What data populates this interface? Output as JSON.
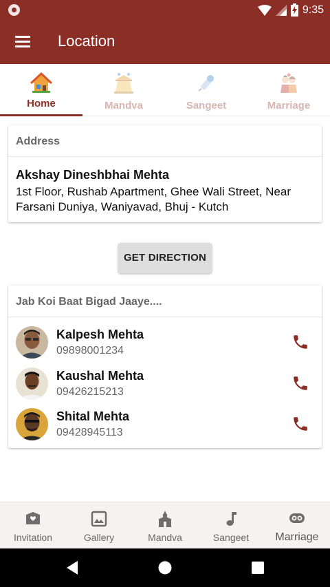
{
  "status_bar": {
    "time": "9:35"
  },
  "app_bar": {
    "title": "Location"
  },
  "tabs": [
    {
      "label": "Home",
      "active": true
    },
    {
      "label": "Mandva",
      "active": false
    },
    {
      "label": "Sangeet",
      "active": false
    },
    {
      "label": "Marriage",
      "active": false
    }
  ],
  "address": {
    "header": "Address",
    "name": "Akshay Dineshbhai Mehta",
    "text": "1st Floor, Rushab Apartment, Ghee Wali Street, Near Farsani Duniya, Waniyavad, Bhuj - Kutch"
  },
  "direction_button": {
    "label": "GET DIRECTION"
  },
  "contacts": {
    "header": "Jab Koi Baat Bigad Jaaye....",
    "items": [
      {
        "name": "Kalpesh Mehta",
        "phone": "09898001234"
      },
      {
        "name": "Kaushal Mehta",
        "phone": "09426215213"
      },
      {
        "name": "Shital Mehta",
        "phone": "09428945113"
      }
    ]
  },
  "bottom_nav": [
    {
      "label": "Invitation",
      "icon": "invitation-icon"
    },
    {
      "label": "Gallery",
      "icon": "gallery-icon"
    },
    {
      "label": "Mandva",
      "icon": "temple-icon"
    },
    {
      "label": "Sangeet",
      "icon": "music-note-icon"
    },
    {
      "label": "Marriage",
      "icon": "couple-icon",
      "selected": true
    }
  ],
  "colors": {
    "primary": "#8b2e26",
    "tab_inactive": "#d7b6b2",
    "nav_bg": "#f6f2f1"
  }
}
